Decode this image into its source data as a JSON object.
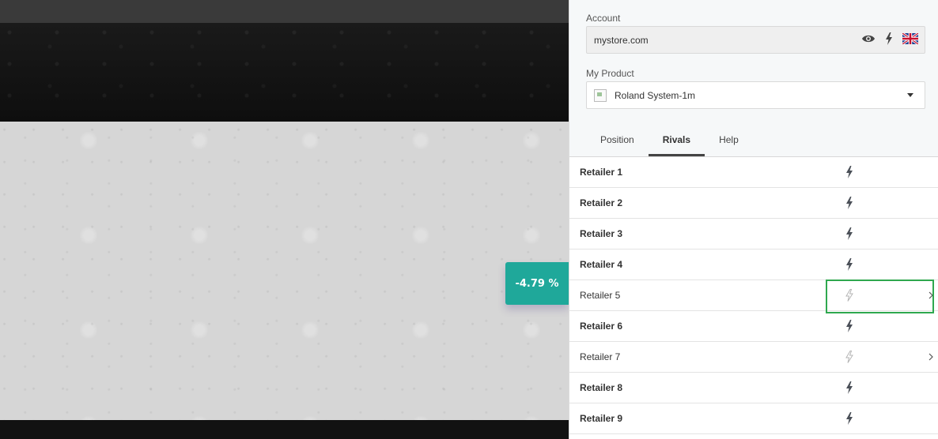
{
  "price_badge": {
    "text": "-4.79 %",
    "color": "#1fa89a"
  },
  "account": {
    "label": "Account",
    "value": "mystore.com",
    "icons": [
      "eye-icon",
      "bolt-icon",
      "uk-flag-icon"
    ]
  },
  "product": {
    "label": "My Product",
    "value": "Roland System-1m"
  },
  "tabs": [
    {
      "label": "Position",
      "active": false
    },
    {
      "label": "Rivals",
      "active": true
    },
    {
      "label": "Help",
      "active": false
    }
  ],
  "rivals": [
    {
      "name": "Retailer 1",
      "bold": true,
      "bolt_active": true,
      "has_chevron": false
    },
    {
      "name": "Retailer 2",
      "bold": true,
      "bolt_active": true,
      "has_chevron": false
    },
    {
      "name": "Retailer 3",
      "bold": true,
      "bolt_active": true,
      "has_chevron": false
    },
    {
      "name": "Retailer 4",
      "bold": true,
      "bolt_active": true,
      "has_chevron": false
    },
    {
      "name": "Retailer 5",
      "bold": false,
      "bolt_active": false,
      "has_chevron": true,
      "highlighted": true
    },
    {
      "name": "Retailer 6",
      "bold": true,
      "bolt_active": true,
      "has_chevron": false
    },
    {
      "name": "Retailer 7",
      "bold": false,
      "bolt_active": false,
      "has_chevron": true
    },
    {
      "name": "Retailer 8",
      "bold": true,
      "bolt_active": true,
      "has_chevron": false
    },
    {
      "name": "Retailer 9",
      "bold": true,
      "bolt_active": true,
      "has_chevron": false
    }
  ],
  "colors": {
    "bolt_active": "#4a4f57",
    "bolt_inactive": "#b5b5b5",
    "highlight": "#2fa84f"
  }
}
